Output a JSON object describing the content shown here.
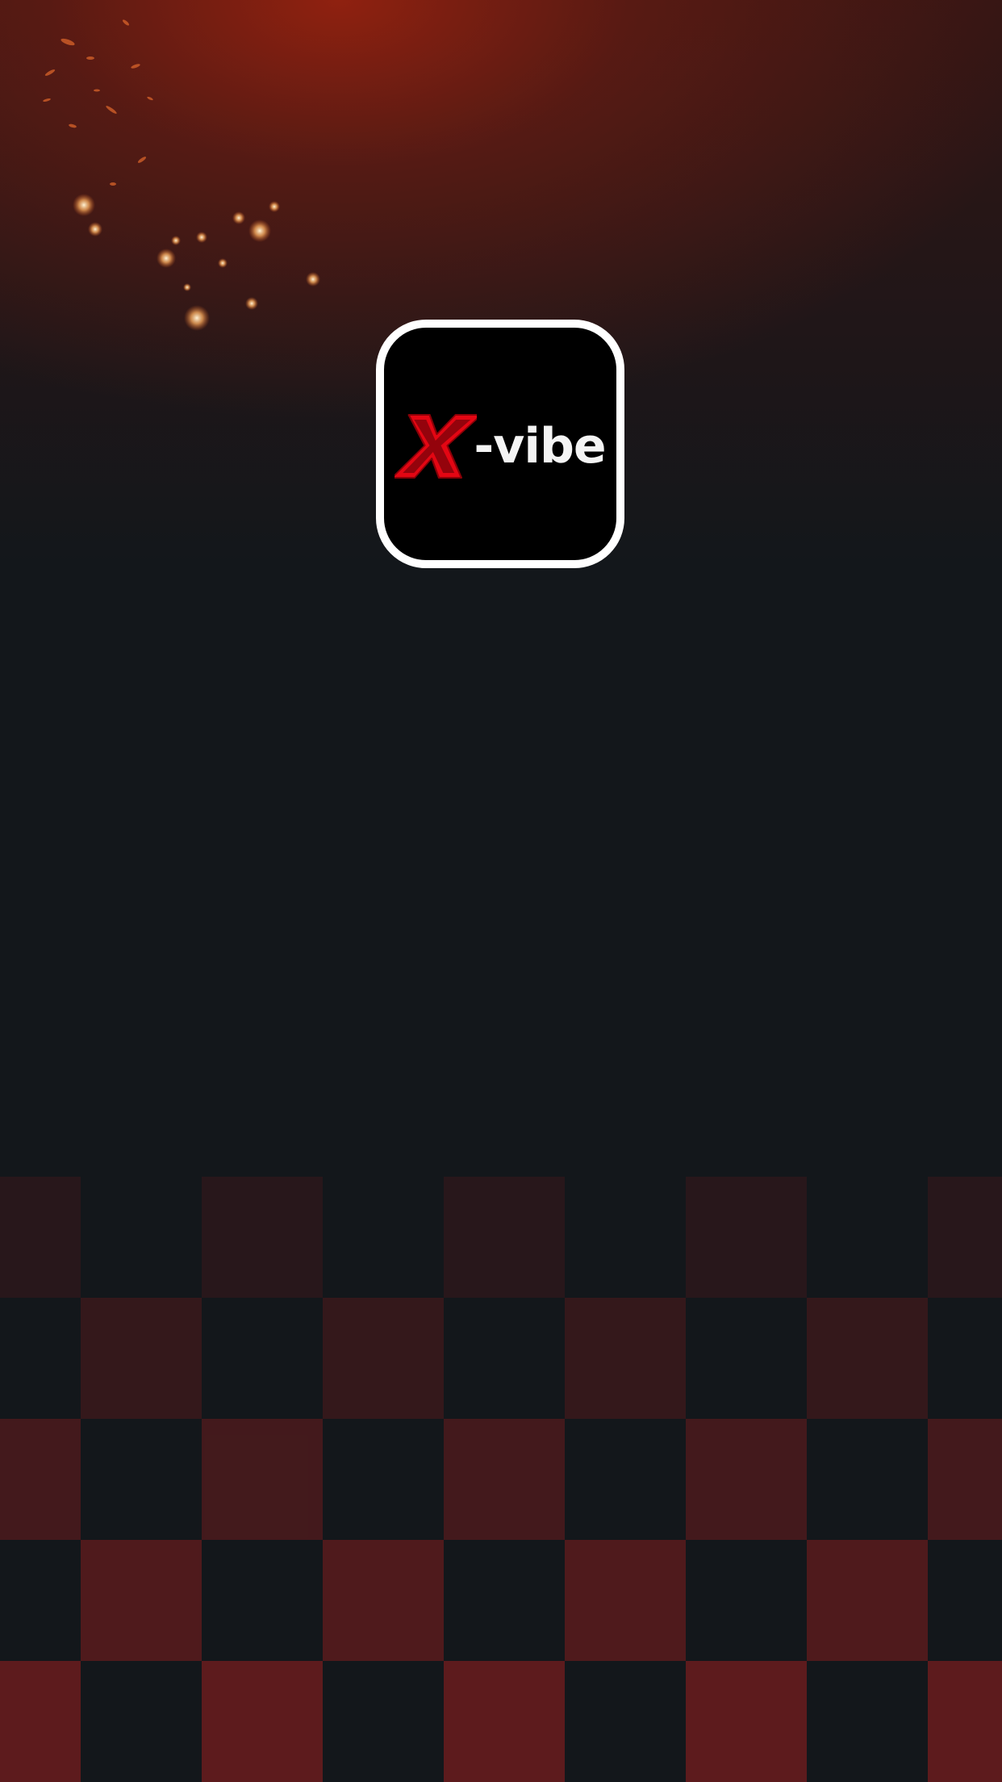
{
  "screen": {
    "name": "splash-screen",
    "background_color": "#13171b",
    "glow_color": "#a0230f"
  },
  "app_icon": {
    "brand_mark": "X",
    "brand_text": "-vibe",
    "mark_color": "#e30613",
    "text_color": "#f4f4f4",
    "frame_color": "#ffffff",
    "icon": "x-vibe-logo-icon"
  },
  "decoration": {
    "sparks_icon": "sparks-icon",
    "checker_pattern": "checkered-flag-pattern",
    "checker_color": "#8b1e1e"
  }
}
